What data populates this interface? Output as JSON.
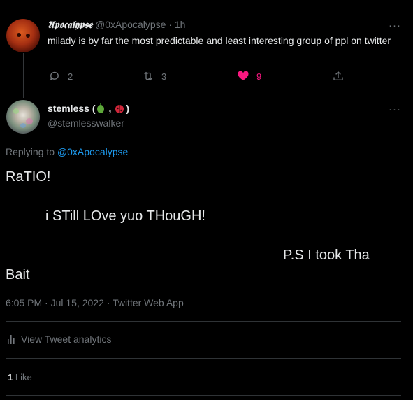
{
  "parent_tweet": {
    "display_name": "𝖀𝖕𝖔𝖈𝖆𝖑𝖞𝖕𝖘𝖊",
    "handle": "@0xApocalypse",
    "time": "· 1h",
    "text": "milady is by far the most predictable and least interesting group of ppl on twitter",
    "replies": "2",
    "retweets": "3",
    "likes": "9",
    "more": "···"
  },
  "main_tweet": {
    "display_name": "stemless (",
    "name_sep": ",",
    "name_close": ")",
    "handle": "@stemlesswalker",
    "more": "···",
    "replying_prefix": "Replying to",
    "replying_to": "@0xApocalypse",
    "line1": "RaTIO!",
    "line2": "i STill LOve yuo THouGH!",
    "line3": "P.S I took Tha",
    "line4": "Bait",
    "timestamp": "6:05 PM · Jul 15, 2022 · Twitter Web App",
    "analytics_label": "View Tweet analytics",
    "likes_count": "1",
    "likes_label": "Like"
  },
  "colors": {
    "background": "#000000",
    "text": "#e7e9ea",
    "muted": "#71767b",
    "link": "#1d9bf0",
    "like": "#f91880",
    "divider": "#2f3336"
  }
}
